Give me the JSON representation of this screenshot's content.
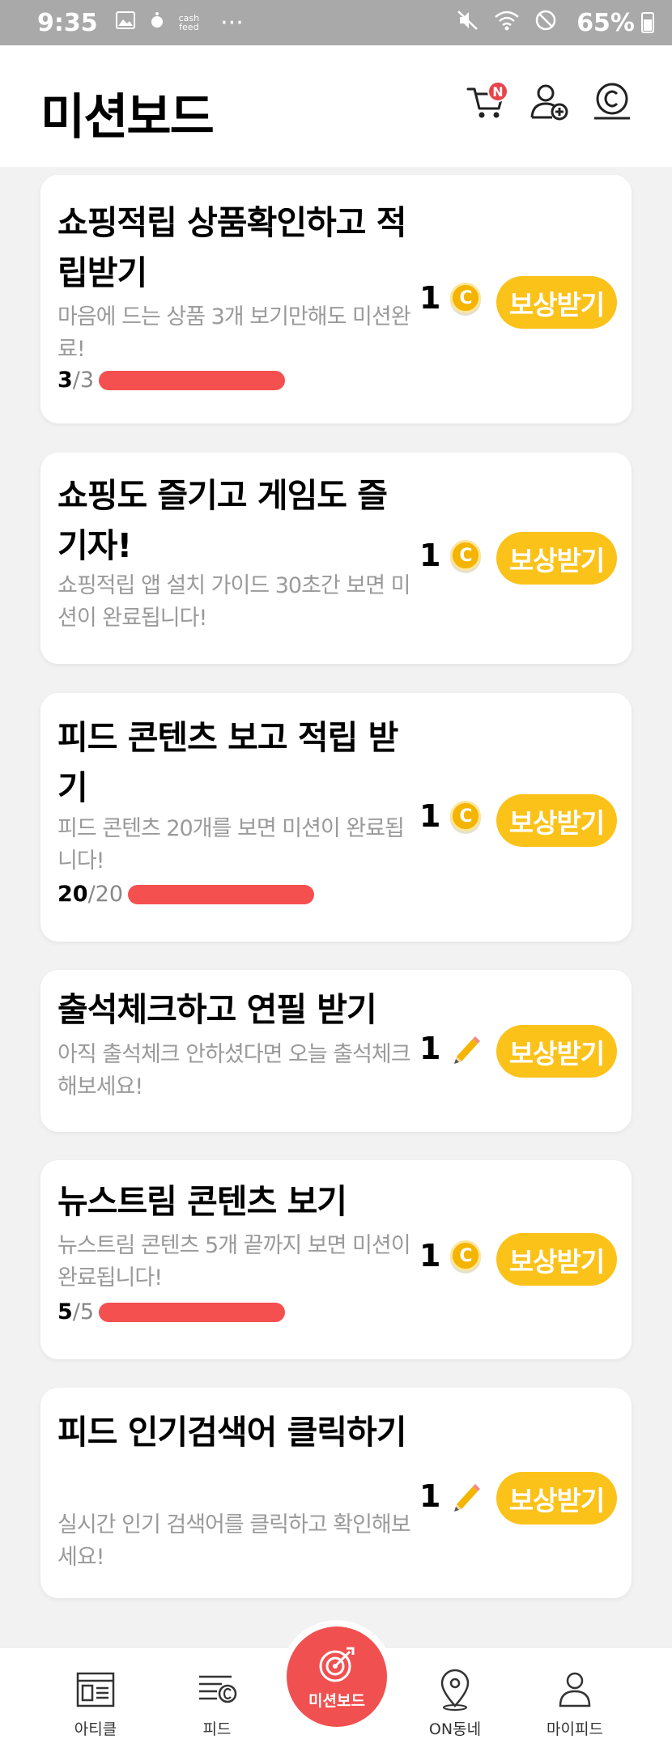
{
  "status_bar": {
    "time": "9:35",
    "cash_label": "cash\nfeed",
    "more": "···",
    "battery": "65%"
  },
  "header": {
    "title": "미션보드",
    "cart_badge": "N"
  },
  "missions": [
    {
      "title": "쇼핑적립 상품확인하고 적립받기",
      "description": "마음에 드는 상품 3개 보기만해도 미션완료!",
      "progress_current": "3",
      "progress_total": "/3",
      "progress_fraction": 1,
      "reward_amount": "1",
      "reward_type": "coin-icon",
      "button_label": "보상받기"
    },
    {
      "title": "쇼핑도 즐기고 게임도 즐기자!",
      "description": "쇼핑적립 앱 설치 가이드 30초간 보면 미션이 완료됩니다!",
      "reward_amount": "1",
      "reward_type": "coin-icon",
      "button_label": "보상받기"
    },
    {
      "title": "피드 콘텐츠 보고 적립 받기",
      "description": "피드 콘텐츠 20개를 보면 미션이 완료됩니다!",
      "progress_current": "20",
      "progress_total": "/20",
      "progress_fraction": 1,
      "reward_amount": "1",
      "reward_type": "coin-icon",
      "button_label": "보상받기"
    },
    {
      "title": "출석체크하고 연필 받기",
      "description": "아직 출석체크 안하셨다면 오늘 출석체크해보세요!",
      "reward_amount": "1",
      "reward_type": "pencil-icon",
      "button_label": "보상받기"
    },
    {
      "title": "뉴스트림 콘텐츠 보기",
      "description": "뉴스트림 콘텐츠 5개 끝까지 보면 미션이 완료됩니다!",
      "progress_current": "5",
      "progress_total": "/5",
      "progress_fraction": 1,
      "reward_amount": "1",
      "reward_type": "coin-icon",
      "button_label": "보상받기"
    },
    {
      "title": "피드 인기검색어 클릭하기",
      "description": "실시간 인기 검색어를 클릭하고 확인해보세요!",
      "reward_amount": "1",
      "reward_type": "pencil-icon",
      "button_label": "보상받기"
    }
  ],
  "bottom_nav": {
    "items": [
      {
        "label": "아티클",
        "icon": "article-icon"
      },
      {
        "label": "피드",
        "icon": "feed-icon"
      },
      {
        "label": "미션보드",
        "icon": "target-icon",
        "active": true
      },
      {
        "label": "ON동네",
        "icon": "location-pin-icon"
      },
      {
        "label": "마이피드",
        "icon": "profile-icon"
      }
    ]
  },
  "colors": {
    "accent_red": "#f15050",
    "progress_red": "#f4504f",
    "reward_yellow": "#fbc21a",
    "coin_gold": "#f4b400"
  }
}
